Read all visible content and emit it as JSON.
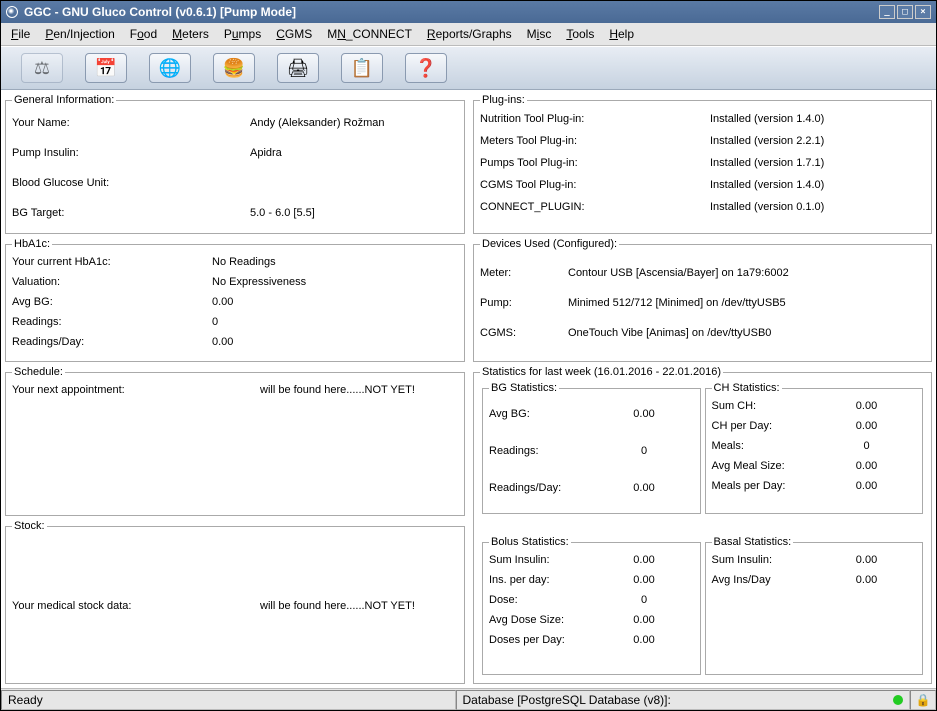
{
  "window": {
    "title": "GGC - GNU Gluco Control (v0.6.1) [Pump Mode]"
  },
  "menu": [
    "File",
    "Pen/Injection",
    "Food",
    "Meters",
    "Pumps",
    "CGMS",
    "MN_CONNECT",
    "Reports/Graphs",
    "Misc",
    "Tools",
    "Help"
  ],
  "toolbar": {
    "btn1": "scale-icon",
    "btn2": "calendar-icon",
    "btn3": "globe-icon",
    "btn4": "food-icon",
    "btn5": "print-icon",
    "btn6": "checklist-icon",
    "btn7": "help-icon"
  },
  "general": {
    "legend": "General Information:",
    "nameLabel": "Your Name:",
    "nameVal": "Andy (Aleksander) Rožman",
    "insulinLabel": "Pump Insulin:",
    "insulinVal": "Apidra",
    "bgUnitLabel": "Blood Glucose Unit:",
    "bgUnitVal": "",
    "bgTargetLabel": "BG Target:",
    "bgTargetVal": "5.0 - 6.0 [5.5]"
  },
  "plugins": {
    "legend": "Plug-ins:",
    "items": [
      {
        "label": "Nutrition Tool Plug-in:",
        "val": "Installed (version 1.4.0)"
      },
      {
        "label": "Meters Tool Plug-in:",
        "val": "Installed (version 2.2.1)"
      },
      {
        "label": "Pumps Tool Plug-in:",
        "val": "Installed (version 1.7.1)"
      },
      {
        "label": "CGMS Tool Plug-in:",
        "val": "Installed (version 1.4.0)"
      },
      {
        "label": "CONNECT_PLUGIN:",
        "val": "Installed (version 0.1.0)"
      }
    ]
  },
  "hba1c": {
    "legend": "HbA1c:",
    "items": [
      {
        "label": "Your current HbA1c:",
        "val": "No Readings"
      },
      {
        "label": "Valuation:",
        "val": "No Expressiveness"
      },
      {
        "label": "Avg BG:",
        "val": "0.00"
      },
      {
        "label": "Readings:",
        "val": "0"
      },
      {
        "label": "Readings/Day:",
        "val": "0.00"
      }
    ]
  },
  "devices": {
    "legend": "Devices Used (Configured):",
    "items": [
      {
        "label": "Meter:",
        "val": "Contour USB [Ascensia/Bayer] on 1a79:6002"
      },
      {
        "label": "Pump:",
        "val": "Minimed 512/712 [Minimed] on /dev/ttyUSB5"
      },
      {
        "label": "CGMS:",
        "val": "OneTouch Vibe [Animas] on /dev/ttyUSB0"
      }
    ]
  },
  "schedule": {
    "legend": "Schedule:",
    "label": "Your next appointment:",
    "val": "will be found here......NOT YET!"
  },
  "stock": {
    "legend": "Stock:",
    "label": "Your medical stock data:",
    "val": "will be found here......NOT YET!"
  },
  "stats": {
    "legend": "Statistics for last week (16.01.2016 - 22.01.2016)",
    "bg": {
      "legend": "BG Statistics:",
      "items": [
        {
          "label": "Avg BG:",
          "val": "0.00"
        },
        {
          "label": "Readings:",
          "val": "0"
        },
        {
          "label": "Readings/Day:",
          "val": "0.00"
        }
      ]
    },
    "ch": {
      "legend": "CH Statistics:",
      "items": [
        {
          "label": "Sum CH:",
          "val": "0.00"
        },
        {
          "label": "CH per Day:",
          "val": "0.00"
        },
        {
          "label": "Meals:",
          "val": "0"
        },
        {
          "label": "Avg Meal Size:",
          "val": "0.00"
        },
        {
          "label": "Meals per Day:",
          "val": "0.00"
        }
      ]
    },
    "bolus": {
      "legend": "Bolus Statistics:",
      "items": [
        {
          "label": "Sum Insulin:",
          "val": "0.00"
        },
        {
          "label": "Ins. per day:",
          "val": "0.00"
        },
        {
          "label": "Dose:",
          "val": "0"
        },
        {
          "label": "Avg Dose Size:",
          "val": "0.00"
        },
        {
          "label": "Doses per Day:",
          "val": "0.00"
        }
      ]
    },
    "basal": {
      "legend": "Basal Statistics:",
      "items": [
        {
          "label": "Sum Insulin:",
          "val": "0.00"
        },
        {
          "label": "Avg Ins/Day",
          "val": "0.00"
        }
      ]
    }
  },
  "status": {
    "left": "Ready",
    "right": "Database [PostgreSQL Database (v8)]:"
  }
}
